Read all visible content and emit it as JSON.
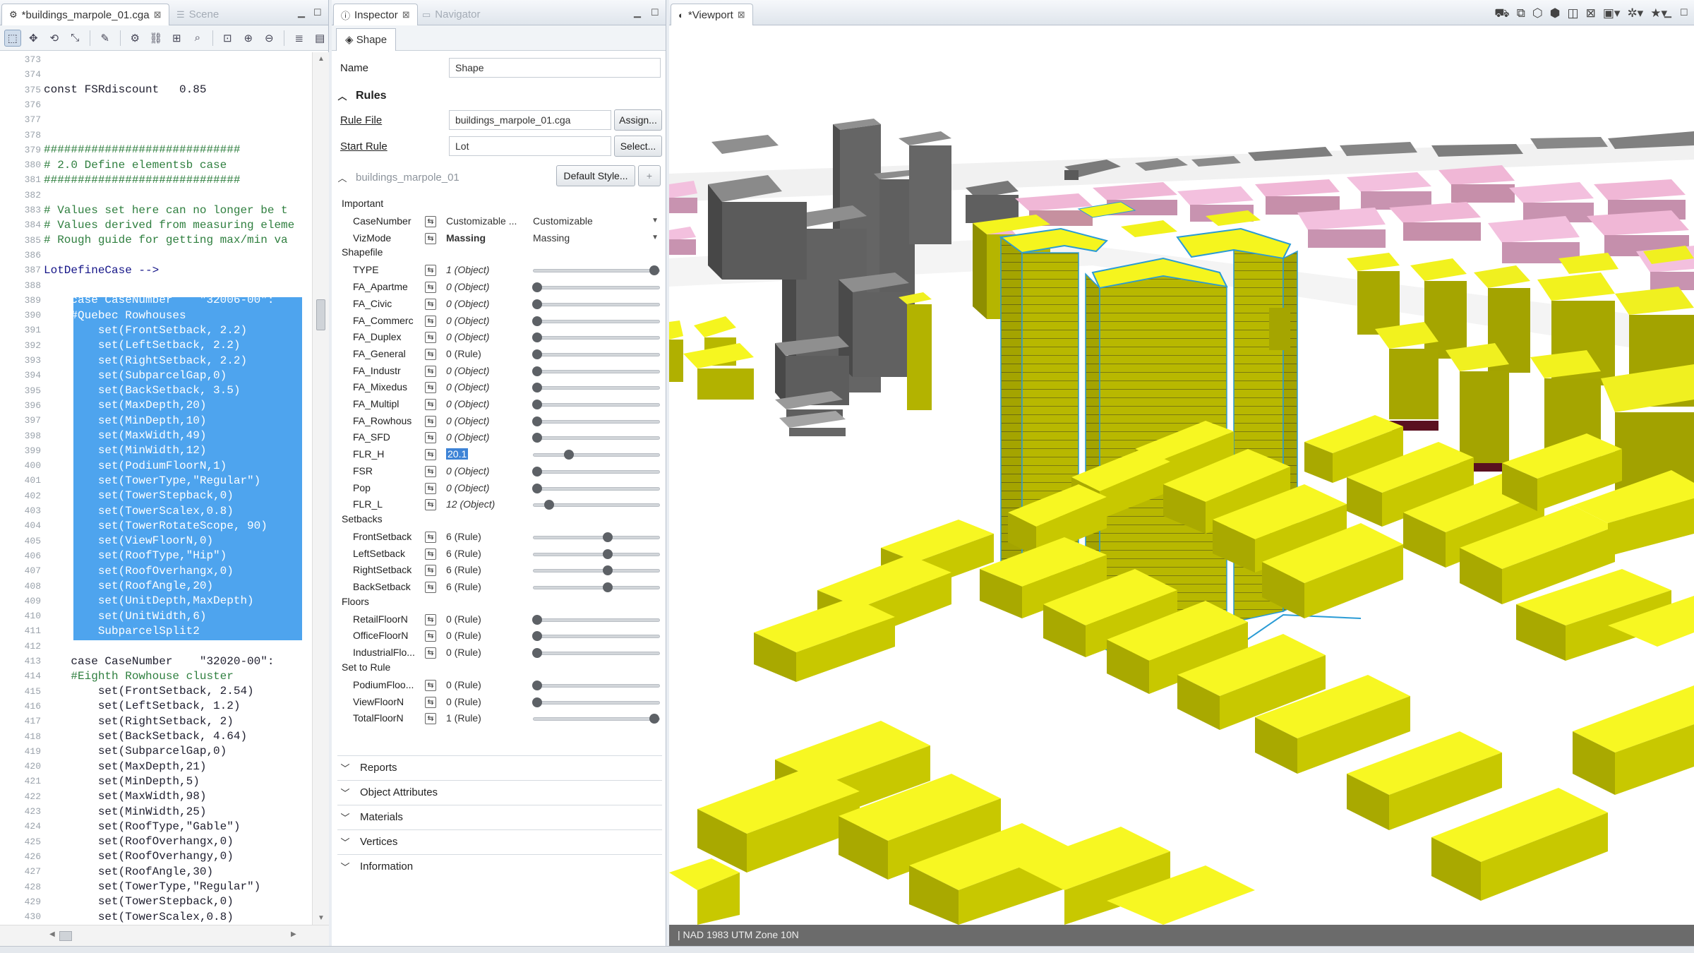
{
  "editor": {
    "tabs": [
      {
        "label": "*buildings_marpole_01.cga",
        "close": "⊠",
        "active": true
      },
      {
        "label": "Scene",
        "close": "",
        "active": false
      }
    ],
    "lines": [
      {
        "n": "373",
        "t": "",
        "c": ""
      },
      {
        "n": "374",
        "t": "",
        "c": ""
      },
      {
        "n": "375",
        "t": "const FSRdiscount   0.85",
        "c": "kw"
      },
      {
        "n": "376",
        "t": "",
        "c": ""
      },
      {
        "n": "377",
        "t": "",
        "c": ""
      },
      {
        "n": "378",
        "t": "",
        "c": ""
      },
      {
        "n": "379",
        "t": "#############################",
        "c": "cm"
      },
      {
        "n": "380",
        "t": "# 2.0 Define elementsb case",
        "c": "cm"
      },
      {
        "n": "381",
        "t": "#############################",
        "c": "cm"
      },
      {
        "n": "382",
        "t": "",
        "c": ""
      },
      {
        "n": "383",
        "t": "# Values set here can no longer be t",
        "c": "cm"
      },
      {
        "n": "384",
        "t": "# Values derived from measuring eleme",
        "c": "cm"
      },
      {
        "n": "385",
        "t": "# Rough guide for getting max/min va",
        "c": "cm"
      },
      {
        "n": "386",
        "t": "",
        "c": ""
      },
      {
        "n": "387",
        "t": "LotDefineCase -->",
        "c": "fn"
      },
      {
        "n": "388",
        "t": "",
        "c": ""
      },
      {
        "n": "389",
        "t": "    case CaseNumber    \"32006-00\":",
        "c": "sel"
      },
      {
        "n": "390",
        "t": "    #Quebec Rowhouses",
        "c": "sel"
      },
      {
        "n": "391",
        "t": "        set(FrontSetback, 2.2)",
        "c": "sel"
      },
      {
        "n": "392",
        "t": "        set(LeftSetback, 2.2)",
        "c": "sel"
      },
      {
        "n": "393",
        "t": "        set(RightSetback, 2.2)",
        "c": "sel"
      },
      {
        "n": "394",
        "t": "        set(SubparcelGap,0)",
        "c": "sel"
      },
      {
        "n": "395",
        "t": "        set(BackSetback, 3.5)",
        "c": "sel"
      },
      {
        "n": "396",
        "t": "        set(MaxDepth,20)",
        "c": "sel"
      },
      {
        "n": "397",
        "t": "        set(MinDepth,10)",
        "c": "sel"
      },
      {
        "n": "398",
        "t": "        set(MaxWidth,49)",
        "c": "sel"
      },
      {
        "n": "399",
        "t": "        set(MinWidth,12)",
        "c": "sel"
      },
      {
        "n": "400",
        "t": "        set(PodiumFloorN,1)",
        "c": "sel"
      },
      {
        "n": "401",
        "t": "        set(TowerType,\"Regular\")",
        "c": "sel"
      },
      {
        "n": "402",
        "t": "        set(TowerStepback,0)",
        "c": "sel"
      },
      {
        "n": "403",
        "t": "        set(TowerScalex,0.8)",
        "c": "sel"
      },
      {
        "n": "404",
        "t": "        set(TowerRotateScope, 90)",
        "c": "sel"
      },
      {
        "n": "405",
        "t": "        set(ViewFloorN,0)",
        "c": "sel"
      },
      {
        "n": "406",
        "t": "        set(RoofType,\"Hip\")",
        "c": "sel"
      },
      {
        "n": "407",
        "t": "        set(RoofOverhangx,0)",
        "c": "sel"
      },
      {
        "n": "408",
        "t": "        set(RoofAngle,20)",
        "c": "sel"
      },
      {
        "n": "409",
        "t": "        set(UnitDepth,MaxDepth)",
        "c": "sel"
      },
      {
        "n": "410",
        "t": "        set(UnitWidth,6)",
        "c": "sel"
      },
      {
        "n": "411",
        "t": "        SubparcelSplit2",
        "c": "sel"
      },
      {
        "n": "412",
        "t": "",
        "c": ""
      },
      {
        "n": "413",
        "t": "    case CaseNumber    \"32020-00\":",
        "c": "kw"
      },
      {
        "n": "414",
        "t": "    #Eighth Rowhouse cluster",
        "c": "cm"
      },
      {
        "n": "415",
        "t": "        set(FrontSetback, 2.54)",
        "c": "kw"
      },
      {
        "n": "416",
        "t": "        set(LeftSetback, 1.2)",
        "c": "kw"
      },
      {
        "n": "417",
        "t": "        set(RightSetback, 2)",
        "c": "kw"
      },
      {
        "n": "418",
        "t": "        set(BackSetback, 4.64)",
        "c": "kw"
      },
      {
        "n": "419",
        "t": "        set(SubparcelGap,0)",
        "c": "kw"
      },
      {
        "n": "420",
        "t": "        set(MaxDepth,21)",
        "c": "kw"
      },
      {
        "n": "421",
        "t": "        set(MinDepth,5)",
        "c": "kw"
      },
      {
        "n": "422",
        "t": "        set(MaxWidth,98)",
        "c": "kw"
      },
      {
        "n": "423",
        "t": "        set(MinWidth,25)",
        "c": "kw"
      },
      {
        "n": "424",
        "t": "        set(RoofType,\"Gable\")",
        "c": "kw"
      },
      {
        "n": "425",
        "t": "        set(RoofOverhangx,0)",
        "c": "kw"
      },
      {
        "n": "426",
        "t": "        set(RoofOverhangy,0)",
        "c": "kw"
      },
      {
        "n": "427",
        "t": "        set(RoofAngle,30)",
        "c": "kw"
      },
      {
        "n": "428",
        "t": "        set(TowerType,\"Regular\")",
        "c": "kw"
      },
      {
        "n": "429",
        "t": "        set(TowerStepback,0)",
        "c": "kw"
      },
      {
        "n": "430",
        "t": "        set(TowerScalex,0.8)",
        "c": "kw"
      }
    ]
  },
  "inspector": {
    "tabs": [
      {
        "label": "Inspector",
        "close": "⊠"
      },
      {
        "label": "Navigator",
        "close": ""
      }
    ],
    "shape_tab": "Shape",
    "name_label": "Name",
    "name_value": "Shape",
    "rules_header": "Rules",
    "rule_file_label": "Rule File",
    "rule_file_value": "buildings_marpole_01.cga",
    "assign_button": "Assign...",
    "start_rule_label": "Start Rule",
    "start_rule_value": "Lot",
    "select_button": "Select...",
    "style_header": "buildings_marpole_01",
    "default_style_button": "Default Style...",
    "add_button": "+",
    "groups": [
      {
        "label": "Important",
        "rows": [
          {
            "name": "CaseNumber",
            "value": "Customizable ...",
            "style": "",
            "control": "combo",
            "combo": "Customizable"
          },
          {
            "name": "VizMode",
            "value": "Massing",
            "style": "bold",
            "control": "combo",
            "combo": "Massing"
          }
        ]
      },
      {
        "label": "Shapefile",
        "rows": [
          {
            "name": "TYPE",
            "value": "1 (Object)",
            "style": "it",
            "control": "slider",
            "pos": 1.0
          },
          {
            "name": "FA_Apartme",
            "value": "0 (Object)",
            "style": "it",
            "control": "slider",
            "pos": 0.0
          },
          {
            "name": "FA_Civic",
            "value": "0 (Object)",
            "style": "it",
            "control": "slider",
            "pos": 0.0
          },
          {
            "name": "FA_Commerc",
            "value": "0 (Object)",
            "style": "it",
            "control": "slider",
            "pos": 0.0
          },
          {
            "name": "FA_Duplex",
            "value": "0 (Object)",
            "style": "it",
            "control": "slider",
            "pos": 0.0
          },
          {
            "name": "FA_General",
            "value": "0 (Rule)",
            "style": "",
            "control": "slider",
            "pos": 0.0
          },
          {
            "name": "FA_Industr",
            "value": "0 (Object)",
            "style": "it",
            "control": "slider",
            "pos": 0.0
          },
          {
            "name": "FA_Mixedus",
            "value": "0 (Object)",
            "style": "it",
            "control": "slider",
            "pos": 0.0
          },
          {
            "name": "FA_Multipl",
            "value": "0 (Object)",
            "style": "it",
            "control": "slider",
            "pos": 0.0
          },
          {
            "name": "FA_Rowhous",
            "value": "0 (Object)",
            "style": "it",
            "control": "slider",
            "pos": 0.0
          },
          {
            "name": "FA_SFD",
            "value": "0 (Object)",
            "style": "it",
            "control": "slider",
            "pos": 0.0
          },
          {
            "name": "FLR_H",
            "value": "20.1",
            "style": "edit",
            "control": "slider",
            "pos": 0.27
          },
          {
            "name": "FSR",
            "value": "0 (Object)",
            "style": "it",
            "control": "slider",
            "pos": 0.0
          },
          {
            "name": "Pop",
            "value": "0 (Object)",
            "style": "it",
            "control": "slider",
            "pos": 0.0
          },
          {
            "name": "FLR_L",
            "value": "12 (Object)",
            "style": "it",
            "control": "slider",
            "pos": 0.1
          }
        ]
      },
      {
        "label": "Setbacks",
        "rows": [
          {
            "name": "FrontSetback",
            "value": "6 (Rule)",
            "style": "",
            "control": "slider",
            "pos": 0.6
          },
          {
            "name": "LeftSetback",
            "value": "6 (Rule)",
            "style": "",
            "control": "slider",
            "pos": 0.6
          },
          {
            "name": "RightSetback",
            "value": "6 (Rule)",
            "style": "",
            "control": "slider",
            "pos": 0.6
          },
          {
            "name": "BackSetback",
            "value": "6 (Rule)",
            "style": "",
            "control": "slider",
            "pos": 0.6
          }
        ]
      },
      {
        "label": "Floors",
        "rows": [
          {
            "name": "RetailFloorN",
            "value": "0 (Rule)",
            "style": "",
            "control": "slider",
            "pos": 0.0
          },
          {
            "name": "OfficeFloorN",
            "value": "0 (Rule)",
            "style": "",
            "control": "slider",
            "pos": 0.0
          },
          {
            "name": "IndustrialFlo...",
            "value": "0 (Rule)",
            "style": "",
            "control": "slider",
            "pos": 0.0
          }
        ]
      },
      {
        "label": "Set to Rule",
        "rows": [
          {
            "name": "PodiumFloo...",
            "value": "0 (Rule)",
            "style": "",
            "control": "slider",
            "pos": 0.0
          },
          {
            "name": "ViewFloorN",
            "value": "0 (Rule)",
            "style": "",
            "control": "slider",
            "pos": 0.0
          },
          {
            "name": "TotalFloorN",
            "value": "1 (Rule)",
            "style": "",
            "control": "slider",
            "pos": 1.0
          }
        ]
      }
    ],
    "collapsed_sections": [
      "Reports",
      "Object Attributes",
      "Materials",
      "Vertices",
      "Information"
    ]
  },
  "viewport": {
    "tab_label": "*Viewport",
    "tab_close": "⊠",
    "status": "NAD 1983 UTM Zone 10N",
    "tools": [
      "camera-icon",
      "grid-icon",
      "wireframe-icon",
      "shaded-icon",
      "layers-icon",
      "bookmark-icon",
      "screenshot-icon",
      "settings-icon",
      "star-icon"
    ],
    "colors": {
      "tower_yellow": "#c4c400",
      "roof_yellow": "#f0f020",
      "context_gray": "#6e6e6e",
      "context_pink": "#efb8d8",
      "ground": "#ffffff"
    }
  }
}
